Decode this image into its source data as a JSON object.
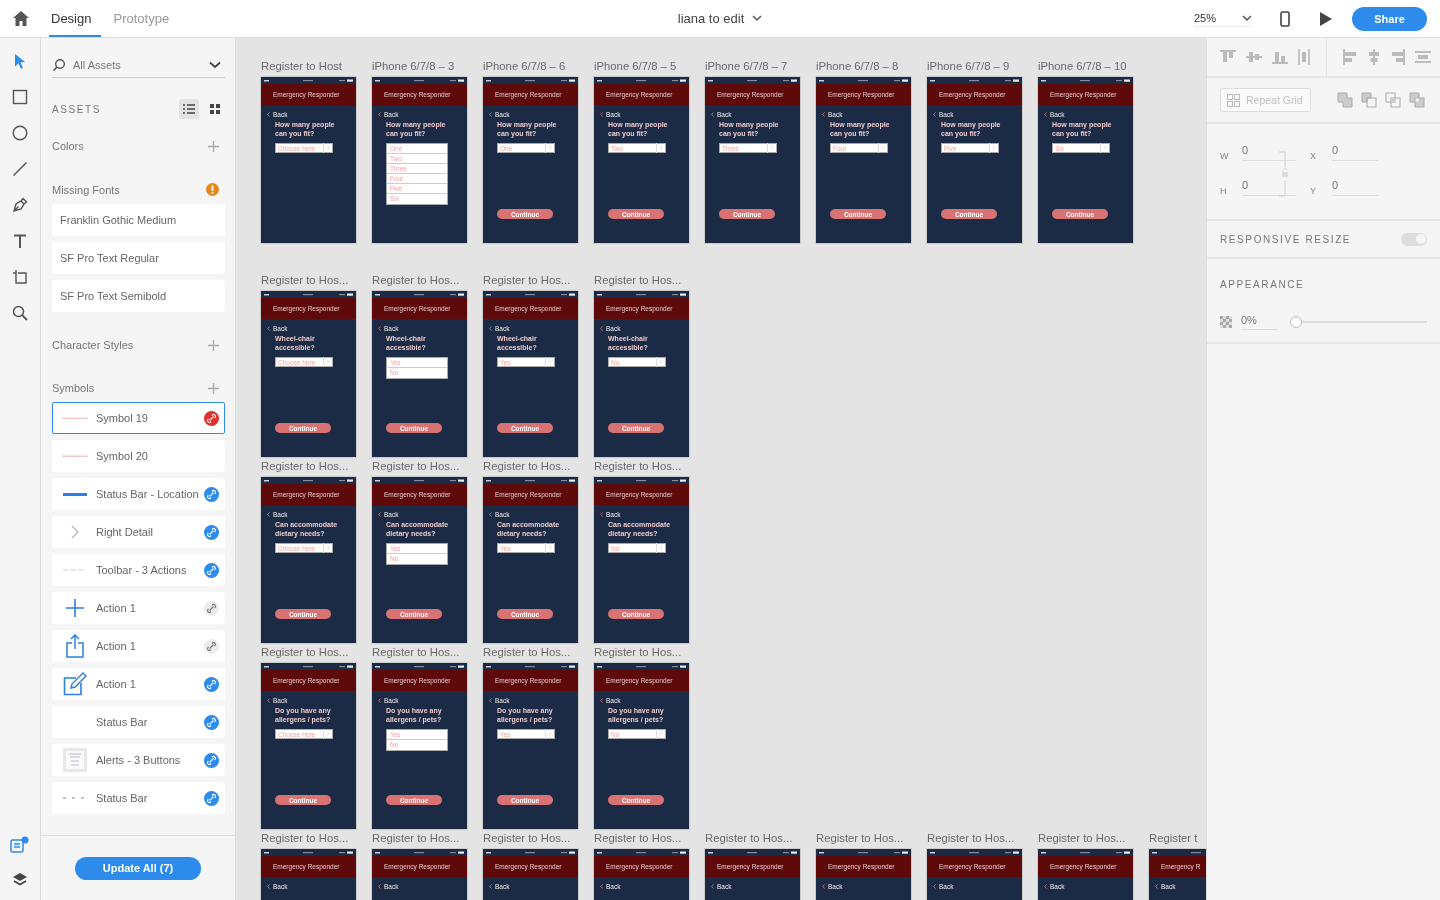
{
  "topbar": {
    "tabs": [
      {
        "label": "Design",
        "selected": true
      },
      {
        "label": "Prototype",
        "selected": false
      }
    ],
    "document": "liana to edit",
    "zoom": "25%",
    "share": "Share"
  },
  "tools": [
    {
      "kind": "select",
      "selected": true
    },
    {
      "kind": "rectangle",
      "selected": false
    },
    {
      "kind": "ellipse",
      "selected": false
    },
    {
      "kind": "line",
      "selected": false
    },
    {
      "kind": "pen",
      "selected": false
    },
    {
      "kind": "text",
      "selected": false
    },
    {
      "kind": "artboard",
      "selected": false
    },
    {
      "kind": "zoom",
      "selected": false
    }
  ],
  "panels": [
    {
      "kind": "assets",
      "selected": true,
      "badge": true
    },
    {
      "kind": "layers",
      "selected": false,
      "badge": false
    }
  ],
  "assets": {
    "search": "All Assets",
    "heading": "ASSETS",
    "views": [
      {
        "kind": "list",
        "selected": true
      },
      {
        "kind": "grid",
        "selected": false
      }
    ],
    "colors": "Colors",
    "missing_fonts": "Missing Fonts",
    "fonts": [
      "Franklin Gothic Medium",
      "SF Pro Text Regular",
      "SF Pro Text Semibold"
    ],
    "character_styles": "Character Styles",
    "symbols_label": "Symbols",
    "symbols": [
      {
        "name": "Symbol 19",
        "kind": "text",
        "selected": true,
        "color": "#e0312f"
      },
      {
        "name": "Symbol 20",
        "kind": "text",
        "selected": false
      },
      {
        "name": "Status Bar - Location",
        "kind": "bar",
        "selected": false,
        "color": "#2d8ceb"
      },
      {
        "name": "Right Detail",
        "kind": "chevron",
        "selected": false,
        "color": "#2d8ceb"
      },
      {
        "name": "Toolbar - 3 Actions",
        "kind": "dots",
        "selected": false,
        "color": "#2d8ceb"
      },
      {
        "name": "Action 1",
        "kind": "plus",
        "selected": false,
        "color": "#ececec"
      },
      {
        "name": "Action 1",
        "kind": "share",
        "selected": false,
        "color": "#ececec"
      },
      {
        "name": "Action 1",
        "kind": "edit",
        "selected": false,
        "color": "#2d8ceb"
      },
      {
        "name": "Status Bar",
        "selected": false,
        "color": "#2d8ceb"
      },
      {
        "name": "Alerts - 3 Buttons",
        "kind": "dialog",
        "selected": false,
        "color": "#2d8ceb"
      },
      {
        "name": "Status Bar",
        "kind": "dashes",
        "selected": false,
        "color": "#2d8ceb"
      }
    ],
    "update": "Update All (7)"
  },
  "canvas": {
    "rows": [
      [
        {
          "title": "Register to Host",
          "header": "Emergency Responder",
          "back": "Back",
          "question": "How many people can you fit?",
          "field": {
            "value": "Choose here"
          }
        },
        {
          "title": "iPhone 6/7/8 – 3",
          "header": "Emergency Responder",
          "back": "Back",
          "question": "How many people can you fit?",
          "field": {
            "options": [
              "One",
              "Two",
              "Three",
              "Four",
              "Five",
              "Six"
            ]
          }
        },
        {
          "title": "iPhone 6/7/8 – 6",
          "header": "Emergency Responder",
          "back": "Back",
          "question": "How many people can you fit?",
          "field": {
            "value": "One"
          },
          "continue": "Continue"
        },
        {
          "title": "iPhone 6/7/8 – 5",
          "header": "Emergency Responder",
          "back": "Back",
          "question": "How many people can you fit?",
          "field": {
            "value": "Two"
          },
          "continue": "Continue"
        },
        {
          "title": "iPhone 6/7/8 – 7",
          "header": "Emergency Responder",
          "back": "Back",
          "question": "How many people can you fit?",
          "field": {
            "value": "Three"
          },
          "continue": "Continue"
        },
        {
          "title": "iPhone 6/7/8 – 8",
          "header": "Emergency Responder",
          "back": "Back",
          "question": "How many people can you fit?",
          "field": {
            "value": "Four"
          },
          "continue": "Continue"
        },
        {
          "title": "iPhone 6/7/8 – 9",
          "header": "Emergency Responder",
          "back": "Back",
          "question": "How many people can you fit?",
          "field": {
            "value": "Five"
          },
          "continue": "Continue"
        },
        {
          "title": "iPhone 6/7/8 – 10",
          "header": "Emergency Responder",
          "back": "Back",
          "question": "How many people can you fit?",
          "field": {
            "value": "Six"
          },
          "continue": "Continue"
        }
      ],
      [
        {
          "title": "Register to Hos...",
          "header": "Emergency Responder",
          "back": "Back",
          "question": "Wheel-chair accessible?",
          "field": {
            "value": "Choose here"
          },
          "continue": "Continue"
        },
        {
          "title": "Register to Hos...",
          "header": "Emergency Responder",
          "back": "Back",
          "question": "Wheel-chair accessible?",
          "field": {
            "options": [
              "Yes",
              "No"
            ]
          },
          "continue": "Continue"
        },
        {
          "title": "Register to Hos...",
          "header": "Emergency Responder",
          "back": "Back",
          "question": "Wheel-chair accessible?",
          "field": {
            "value": "Yes"
          },
          "continue": "Continue"
        },
        {
          "title": "Register to Hos...",
          "header": "Emergency Responder",
          "back": "Back",
          "question": "Wheel-chair accessible?",
          "field": {
            "value": "No"
          },
          "continue": "Continue"
        }
      ],
      [
        {
          "title": "Register to Hos...",
          "header": "Emergency Responder",
          "back": "Back",
          "question": "Can accommodate dietary needs?",
          "field": {
            "value": "Choose here"
          },
          "continue": "Continue"
        },
        {
          "title": "Register to Hos...",
          "header": "Emergency Responder",
          "back": "Back",
          "question": "Can accommodate dietary needs?",
          "field": {
            "options": [
              "Yes",
              "No"
            ]
          },
          "continue": "Continue"
        },
        {
          "title": "Register to Hos...",
          "header": "Emergency Responder",
          "back": "Back",
          "question": "Can accommodate dietary needs?",
          "field": {
            "value": "Yes"
          },
          "continue": "Continue"
        },
        {
          "title": "Register to Hos...",
          "header": "Emergency Responder",
          "back": "Back",
          "question": "Can accommodate dietary needs?",
          "field": {
            "value": "No"
          },
          "continue": "Continue"
        }
      ],
      [
        {
          "title": "Register to Hos...",
          "header": "Emergency Responder",
          "back": "Back",
          "question": "Do you have any allergens / pets?",
          "field": {
            "value": "Choose here"
          },
          "continue": "Continue"
        },
        {
          "title": "Register to Hos...",
          "header": "Emergency Responder",
          "back": "Back",
          "question": "Do you have any allergens / pets?",
          "field": {
            "options": [
              "Yes",
              "No"
            ]
          },
          "continue": "Continue"
        },
        {
          "title": "Register to Hos...",
          "header": "Emergency Responder",
          "back": "Back",
          "question": "Do you have any allergens / pets?",
          "field": {
            "value": "Yes"
          },
          "continue": "Continue"
        },
        {
          "title": "Register to Hos...",
          "header": "Emergency Responder",
          "back": "Back",
          "question": "Do you have any allergens / pets?",
          "field": {
            "value": "No"
          },
          "continue": "Continue"
        }
      ],
      [
        {
          "title": "Register to Hos...",
          "header": "Emergency Responder",
          "back": "Back"
        },
        {
          "title": "Register to Hos...",
          "header": "Emergency Responder",
          "back": "Back"
        },
        {
          "title": "Register to Hos...",
          "header": "Emergency Responder",
          "back": "Back"
        },
        {
          "title": "Register to Hos...",
          "header": "Emergency Responder",
          "back": "Back"
        },
        {
          "title": "Register to Hos...",
          "header": "Emergency Responder",
          "back": "Back"
        },
        {
          "title": "Register to Hos...",
          "header": "Emergency Responder",
          "back": "Back"
        },
        {
          "title": "Register to Hos...",
          "header": "Emergency Responder",
          "back": "Back"
        },
        {
          "title": "Register to Hos...",
          "header": "Emergency Responder",
          "back": "Back"
        },
        {
          "title": "Register t",
          "header": "Emergency R",
          "back": "Back"
        }
      ]
    ]
  },
  "inspector": {
    "repeat_grid": {
      "label": "Repeat Grid",
      "disabled": true
    },
    "geometry": [
      {
        "label": "W",
        "value": "0"
      },
      {
        "label": "X",
        "value": "0"
      },
      {
        "label": "H",
        "value": "0"
      },
      {
        "label": "Y",
        "value": "0"
      }
    ],
    "responsive": {
      "label": "RESPONSIVE RESIZE",
      "on": true
    },
    "appearance": {
      "label": "APPEARANCE",
      "opacity": "0%",
      "level": 0
    }
  }
}
